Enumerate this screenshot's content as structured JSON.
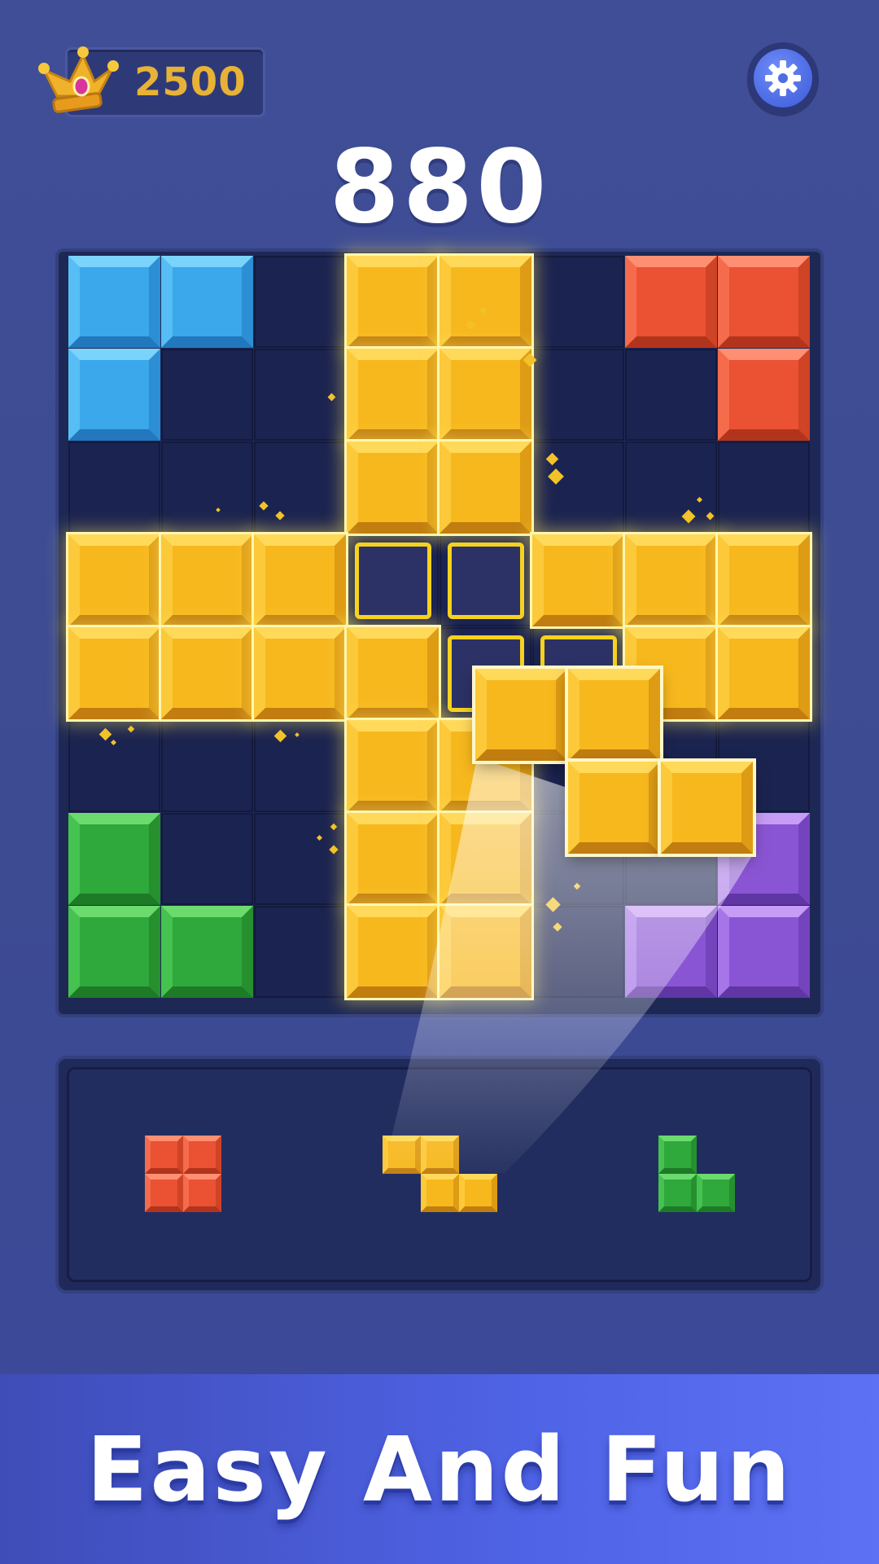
{
  "header": {
    "best_score": "2500",
    "best_icon": "crown-icon",
    "settings_icon": "gear-icon"
  },
  "score": "880",
  "board": {
    "rows": 8,
    "cols": 8,
    "cells": [
      [
        "blue",
        "blue",
        null,
        "yellow",
        "yellow",
        null,
        "red",
        "red"
      ],
      [
        "blue",
        null,
        null,
        "yellow",
        "yellow",
        null,
        null,
        "red"
      ],
      [
        null,
        null,
        null,
        "yellow",
        "yellow",
        null,
        null,
        null
      ],
      [
        "yellow",
        "yellow",
        "yellow",
        null,
        null,
        "yellow",
        "yellow",
        "yellow"
      ],
      [
        "yellow",
        "yellow",
        "yellow",
        "yellow",
        null,
        null,
        "yellow",
        "yellow"
      ],
      [
        null,
        null,
        null,
        "yellow",
        "yellow",
        null,
        null,
        null
      ],
      [
        "green",
        null,
        null,
        "yellow",
        "yellow",
        null,
        null,
        "purple"
      ],
      [
        "green",
        "green",
        null,
        "yellow",
        "yellow",
        null,
        "purple",
        "purple"
      ]
    ],
    "clearing_rows": [
      3,
      4
    ],
    "clearing_cols": [
      3,
      4
    ],
    "placement_preview": [
      [
        3,
        3
      ],
      [
        3,
        4
      ],
      [
        4,
        4
      ],
      [
        4,
        5
      ]
    ]
  },
  "dragging_piece": {
    "color": "yellow",
    "shape": [
      [
        1,
        1,
        0
      ],
      [
        0,
        1,
        1
      ]
    ]
  },
  "tray": {
    "pieces": [
      {
        "color": "red",
        "shape": [
          [
            1,
            1
          ],
          [
            1,
            1
          ]
        ]
      },
      {
        "color": "yellow",
        "shape": [
          [
            1,
            1,
            0
          ],
          [
            0,
            1,
            1
          ]
        ]
      },
      {
        "color": "green",
        "shape": [
          [
            1,
            0
          ],
          [
            1,
            1
          ]
        ]
      }
    ]
  },
  "colors": {
    "yellow": {
      "face": "#f7b81e",
      "top": "#ffd95a",
      "left": "#fcc93a",
      "right": "#de9b14",
      "bottom": "#c17d10"
    },
    "blue": {
      "face": "#3aa8ea",
      "top": "#7ad3fb",
      "left": "#56bdf5",
      "right": "#2c8fd4",
      "bottom": "#2277bd"
    },
    "red": {
      "face": "#ea5233",
      "top": "#ff8f72",
      "left": "#f46c4c",
      "right": "#cf4326",
      "bottom": "#b3341c"
    },
    "green": {
      "face": "#2fa83c",
      "top": "#6cdb6e",
      "left": "#45c24f",
      "right": "#26902f",
      "bottom": "#1d7a27"
    },
    "purple": {
      "face": "#8a55d4",
      "top": "#c79cf6",
      "left": "#a676e8",
      "right": "#7444bd",
      "bottom": "#5f36a3"
    }
  },
  "banner": {
    "text": "Easy And Fun"
  }
}
